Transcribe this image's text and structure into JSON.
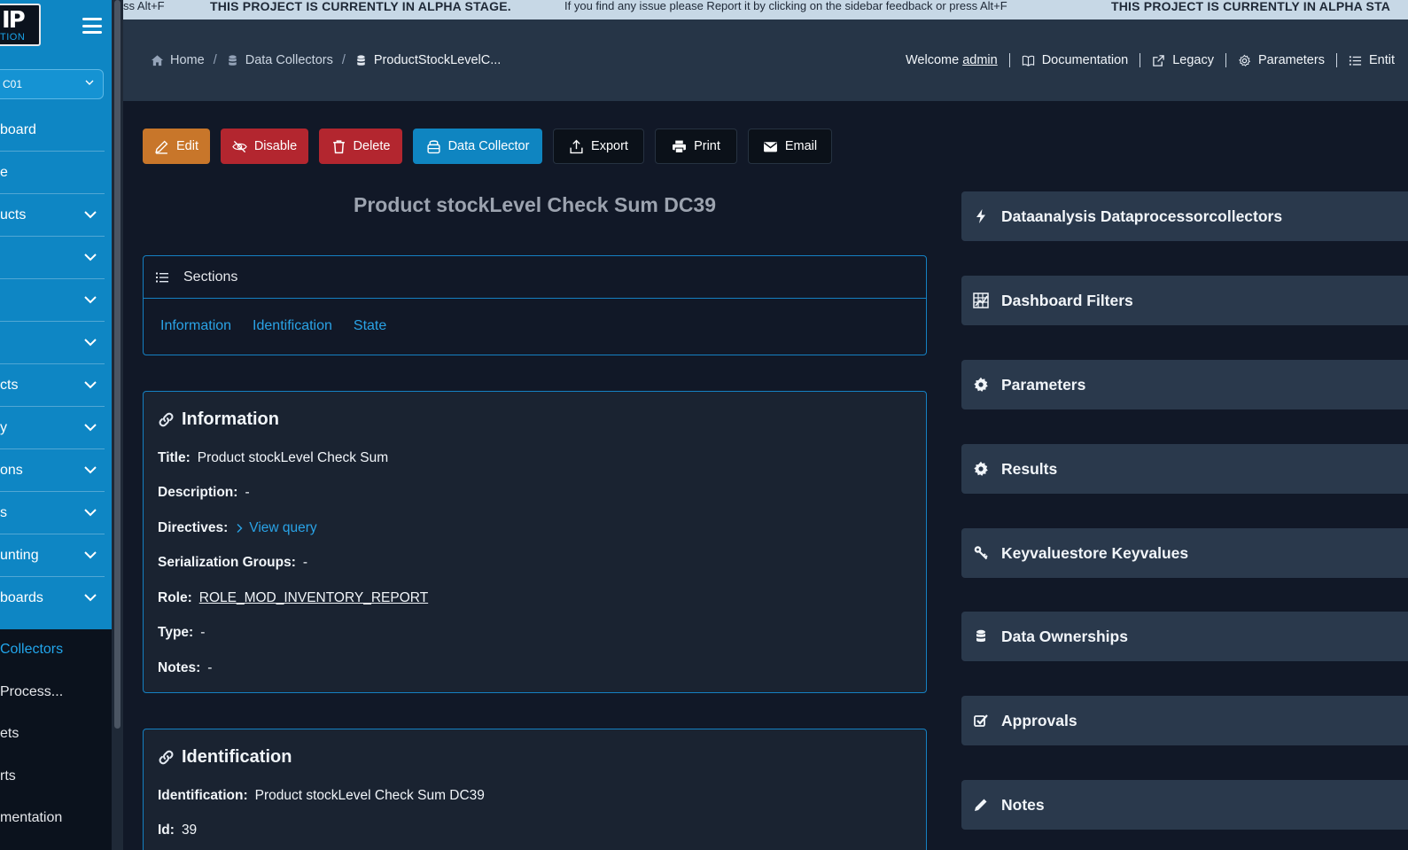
{
  "ticker": {
    "segments": [
      "ss Alt+F",
      "THIS PROJECT IS CURRENTLY IN ALPHA STAGE.",
      "If you find any issue please Report it by clicking on the sidebar feedback or press Alt+F",
      "THIS PROJECT IS CURRENTLY IN ALPHA STA"
    ]
  },
  "sidebar": {
    "logo_big": "IP",
    "logo_small": "TION",
    "company": "C01",
    "items": [
      {
        "label": "board",
        "expandable": false
      },
      {
        "label": "e",
        "expandable": false
      },
      {
        "label": "ucts",
        "expandable": true
      },
      {
        "label": "",
        "expandable": true
      },
      {
        "label": "",
        "expandable": true
      },
      {
        "label": "",
        "expandable": true
      },
      {
        "label": "cts",
        "expandable": true
      },
      {
        "label": "y",
        "expandable": true
      },
      {
        "label": "ons",
        "expandable": true
      },
      {
        "label": "s",
        "expandable": true
      },
      {
        "label": "unting",
        "expandable": true
      },
      {
        "label": "boards",
        "expandable": true
      }
    ],
    "subitems": [
      {
        "label": "Collectors",
        "active": true
      },
      {
        "label": "Process...",
        "active": false
      },
      {
        "label": "ets",
        "active": false
      },
      {
        "label": "rts",
        "active": false
      },
      {
        "label": "mentation",
        "active": false
      }
    ]
  },
  "header": {
    "breadcrumb": [
      "Home",
      "Data Collectors",
      "ProductStockLevelC..."
    ],
    "welcome_prefix": "Welcome",
    "user": "admin",
    "links": [
      "Documentation",
      "Legacy",
      "Parameters",
      "Entit"
    ]
  },
  "toolbar": {
    "edit": "Edit",
    "disable": "Disable",
    "delete": "Delete",
    "data_collector": "Data Collector",
    "export": "Export",
    "print": "Print",
    "email": "Email"
  },
  "page_title": "Product stockLevel Check Sum DC39",
  "sections": {
    "title": "Sections",
    "links": [
      "Information",
      "Identification",
      "State"
    ]
  },
  "information": {
    "title": "Information",
    "fields": {
      "title_label": "Title:",
      "title_value": "Product stockLevel Check Sum",
      "description_label": "Description:",
      "description_value": "-",
      "directives_label": "Directives:",
      "directives_value": "View query",
      "serialization_label": "Serialization Groups:",
      "serialization_value": "-",
      "role_label": "Role:",
      "role_value": "ROLE_MOD_INVENTORY_REPORT",
      "type_label": "Type:",
      "type_value": "-",
      "notes_label": "Notes:",
      "notes_value": "-"
    }
  },
  "identification": {
    "title": "Identification",
    "fields": {
      "identification_label": "Identification:",
      "identification_value": "Product stockLevel Check Sum DC39",
      "id_label": "Id:",
      "id_value": "39"
    }
  },
  "panels": [
    {
      "label": "Dataanalysis Dataprocessorcollectors",
      "icon": "bolt-icon"
    },
    {
      "label": "Dashboard Filters",
      "icon": "filter-grid-icon"
    },
    {
      "label": "Parameters",
      "icon": "gear-icon"
    },
    {
      "label": "Results",
      "icon": "gear-icon"
    },
    {
      "label": "Keyvaluestore Keyvalues",
      "icon": "key-icon"
    },
    {
      "label": "Data Ownerships",
      "icon": "database-icon"
    },
    {
      "label": "Approvals",
      "icon": "checkbox-icon"
    },
    {
      "label": "Notes",
      "icon": "pencil-icon"
    }
  ],
  "colors": {
    "sidebar_blue": "#0e86c4",
    "accent_link": "#2aa3e6",
    "edit_orange": "#c8762a",
    "danger_red": "#b3262f"
  }
}
